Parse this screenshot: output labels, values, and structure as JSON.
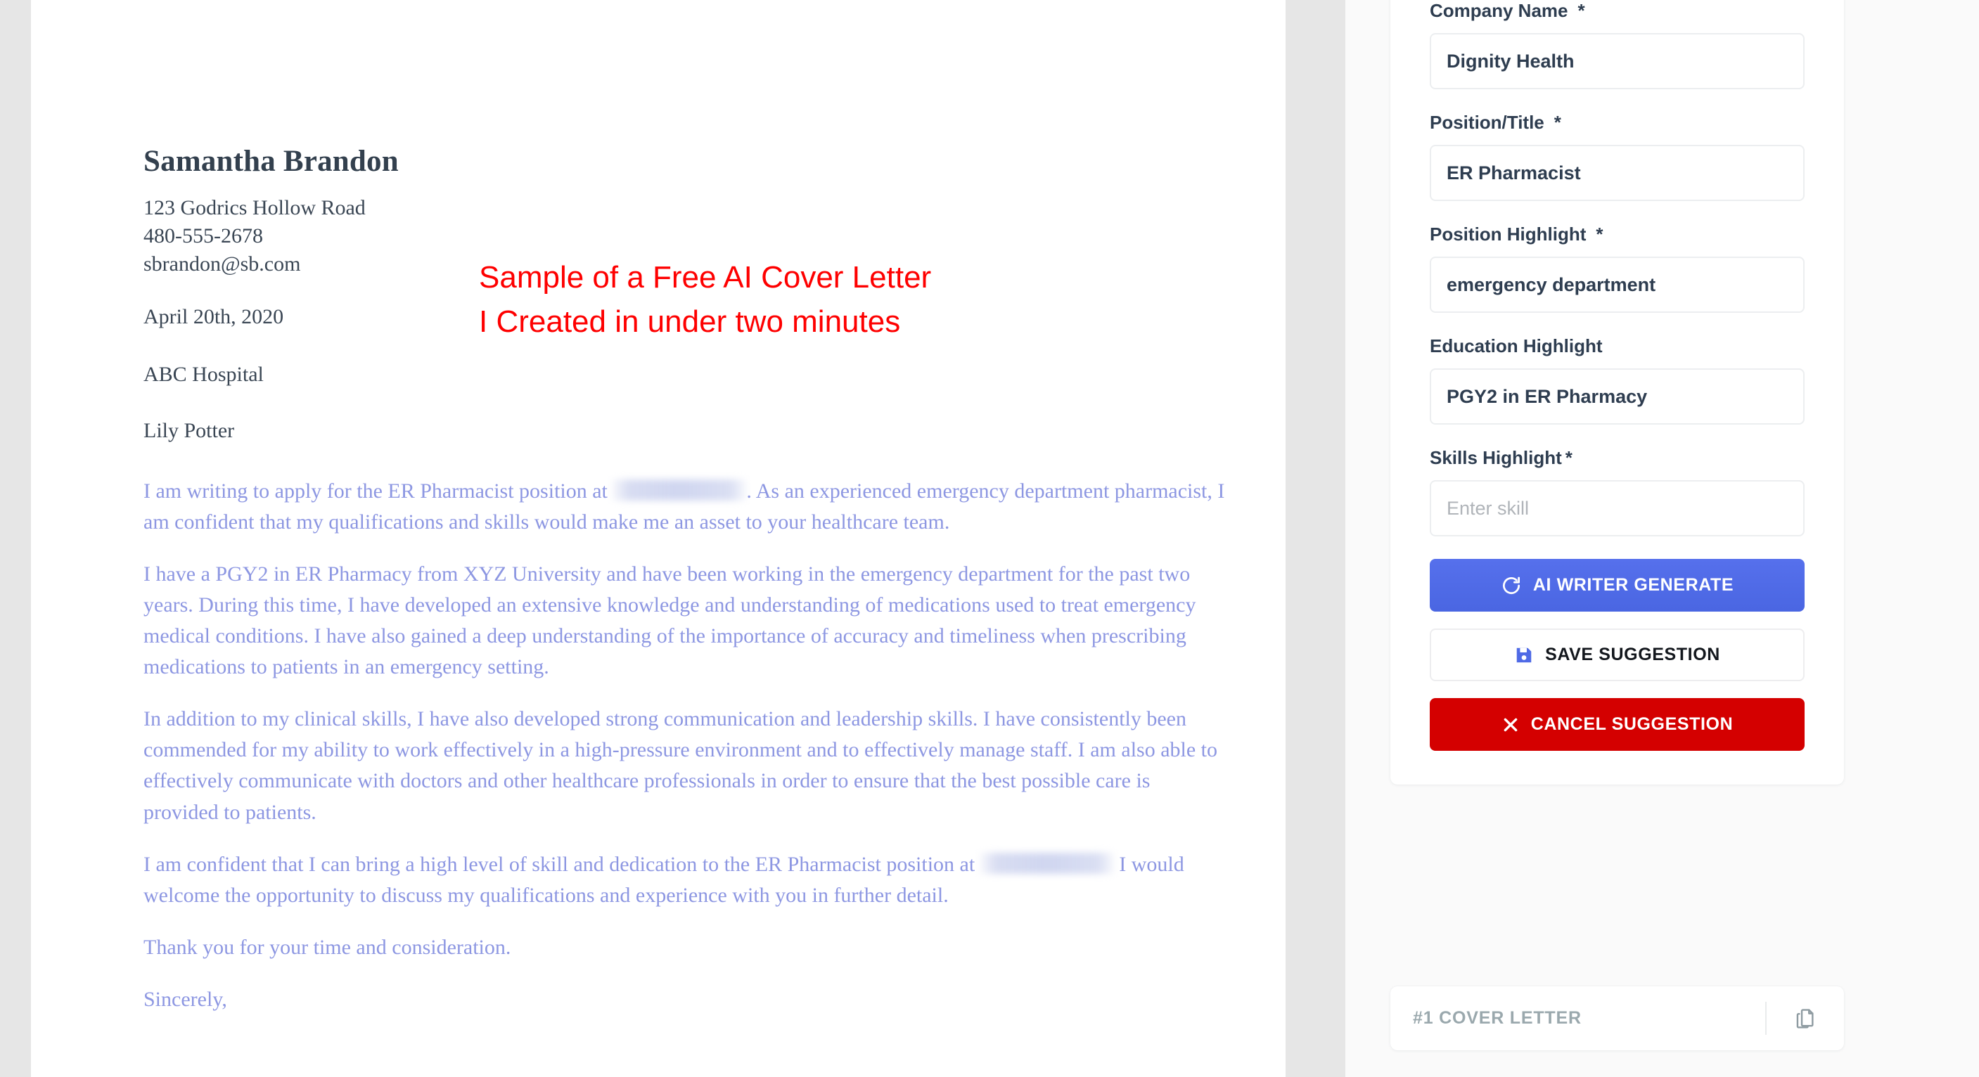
{
  "document": {
    "name": "Samantha Brandon",
    "contact": [
      "123 Godrics Hollow Road",
      "480-555-2678",
      "sbrandon@sb.com"
    ],
    "date": "April 20th, 2020",
    "company": "ABC Hospital",
    "recipient": "Lily Potter",
    "paragraphs": [
      {
        "before": "I am writing to apply for the ER Pharmacist position at ",
        "redacted": true,
        "after": ". As an experienced emergency department pharmacist, I am confident that my qualifications and skills would make me an asset to your healthcare team."
      },
      {
        "before": "I have a PGY2 in ER Pharmacy from XYZ University and have been working in the emergency department for the past two years. During this time, I have developed an extensive knowledge and understanding of medications used to treat emergency medical conditions. I have also gained a deep understanding of the importance of accuracy and timeliness when prescribing medications to patients in an emergency setting.",
        "redacted": false,
        "after": ""
      },
      {
        "before": "In addition to my clinical skills, I have also developed strong communication and leadership skills. I have consistently been commended for my ability to work effectively in a high-pressure environment and to effectively manage staff. I am also able to effectively communicate with doctors and other healthcare professionals in order to ensure that the best possible care is provided to patients.",
        "redacted": false,
        "after": ""
      },
      {
        "before": "I am confident that I can bring a high level of skill and dedication to the ER Pharmacist position at ",
        "redacted": true,
        "after": " I would welcome the opportunity to discuss my qualifications and experience with you in further detail."
      },
      {
        "before": "Thank you for your time and consideration.",
        "redacted": false,
        "after": ""
      },
      {
        "before": "Sincerely,",
        "redacted": false,
        "after": ""
      }
    ]
  },
  "annotation": {
    "line1": "Sample of a Free AI Cover Letter",
    "line2": "I Created in under two minutes",
    "color": "#fe0000"
  },
  "form": {
    "fields": [
      {
        "label": "Company Name",
        "required_marker": "*",
        "required_tight": false,
        "value": "Dignity Health",
        "is_placeholder": false
      },
      {
        "label": "Position/Title",
        "required_marker": "*",
        "required_tight": false,
        "value": "ER Pharmacist",
        "is_placeholder": false
      },
      {
        "label": "Position Highlight",
        "required_marker": "*",
        "required_tight": false,
        "value": "emergency department",
        "is_placeholder": false
      },
      {
        "label": "Education Highlight",
        "required_marker": "",
        "required_tight": false,
        "value": "PGY2 in ER Pharmacy",
        "is_placeholder": false
      },
      {
        "label": "Skills Highlight",
        "required_marker": "*",
        "required_tight": true,
        "value": "Enter skill",
        "is_placeholder": true
      }
    ],
    "buttons": {
      "generate": {
        "label": "AI WRITER GENERATE",
        "icon": "refresh-icon",
        "color": "#4f6ae6"
      },
      "save": {
        "label": "SAVE SUGGESTION",
        "icon": "floppy-disk-icon",
        "color": "#ffffff"
      },
      "cancel": {
        "label": "CANCEL SUGGESTION",
        "icon": "close-x-icon",
        "color": "#d40000"
      }
    }
  },
  "result": {
    "label": "#1 COVER LETTER",
    "copy_icon": "copy-documents-icon"
  }
}
